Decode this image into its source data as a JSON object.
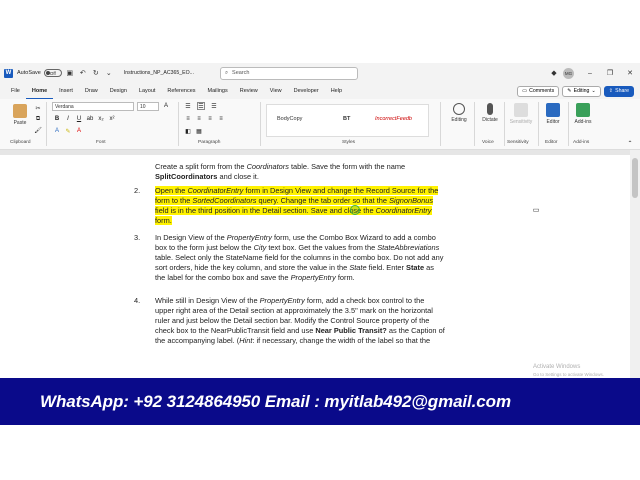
{
  "titlebar": {
    "word_logo": "W",
    "autosave_label": "AutoSave",
    "autosave_state": "Off",
    "document_name": "Instructions_NP_AC365_EO...",
    "search_placeholder": "Search",
    "user_initials": "MG"
  },
  "menu": {
    "tabs": [
      "File",
      "Home",
      "Insert",
      "Draw",
      "Design",
      "Layout",
      "References",
      "Mailings",
      "Review",
      "View",
      "Developer",
      "Help"
    ],
    "active_tab": "Home",
    "comments_label": "Comments",
    "editing_label": "Editing",
    "share_label": "Share"
  },
  "ribbon": {
    "paste_label": "Paste",
    "clipboard_label": "Clipboard",
    "font_name": "Verdana",
    "font_size": "10",
    "font_label": "Font",
    "paragraph_label": "Paragraph",
    "styles": [
      "BodyCopy",
      "BT",
      "IncorrectFeedb"
    ],
    "styles_label": "Styles",
    "editing_btn": "Editing",
    "dictate_btn": "Dictate",
    "sensitivity_btn": "Sensitivity",
    "editor_btn": "Editor",
    "addins_btn": "Add-ins",
    "voice_label": "Voice",
    "sensitivity_label": "Sensitivity",
    "editor_label": "Editor",
    "addins_label": "Add-ins"
  },
  "document": {
    "item1": {
      "line1_a": "Create a split form from the ",
      "line1_b": "Coordinators",
      "line1_c": " table. Save the form with the name",
      "line2_a": "SplitCoordinators",
      "line2_b": " and close it."
    },
    "item2": {
      "number": "2.",
      "line1_a": "Open the ",
      "line1_b": "CoordinatorEntry",
      "line1_c": " form in Design View and change the Record Source for the",
      "line2_a": "form to the ",
      "line2_b": "SortedCoordinators",
      "line2_c": " query. Change the tab order so that the ",
      "line2_d": "SignonBonus",
      "line3_a": "field is in the third position in the Detail section. Save and close the ",
      "line3_b": "CoordinatorEntry",
      "line4": "form."
    },
    "item3": {
      "number": "3.",
      "line1_a": "In Design View of the ",
      "line1_b": "PropertyEntry",
      "line1_c": " form, use the Combo Box Wizard to add a combo",
      "line2_a": "box to the form just below the ",
      "line2_b": "City",
      "line2_c": " text box. Get the values from the ",
      "line2_d": "StateAbbreviations",
      "line3": "table. Select only the StateName field for the columns in the combo box. Do not add any",
      "line4_a": "sort orders, hide the key column, and store the value in the ",
      "line4_b": "State",
      "line4_c": " field. Enter ",
      "line4_d": "State",
      "line4_e": " as",
      "line5_a": "the label for the combo box and save the ",
      "line5_b": "PropertyEntry",
      "line5_c": " form."
    },
    "item4": {
      "number": "4.",
      "line1_a": "While still in Design View of the ",
      "line1_b": "PropertyEntry",
      "line1_c": " form, add a check box control to the",
      "line2": "upper right area of the Detail section at approximately the 3.5\" mark on the horizontal",
      "line3": "ruler and just below the Detail section bar. Modify the Control Source property of the",
      "line4_a": "check box to the NearPublicTransit field and use ",
      "line4_b": "Near Public Transit?",
      "line4_c": " as the Caption of",
      "line5_a": "the accompanying label. (",
      "line5_b": "Hint",
      "line5_c": ": if necessary, change the width of the label so that the"
    },
    "watermark_line1": "Activate Windows",
    "watermark_line2": "Go to Settings to activate Windows."
  },
  "banner": {
    "text": "WhatsApp: +92 3124864950    Email : myitlab492@gmail.com"
  },
  "colors": {
    "highlight": "#fff200",
    "banner_bg": "#0a0a8a",
    "word_blue": "#185abd"
  }
}
